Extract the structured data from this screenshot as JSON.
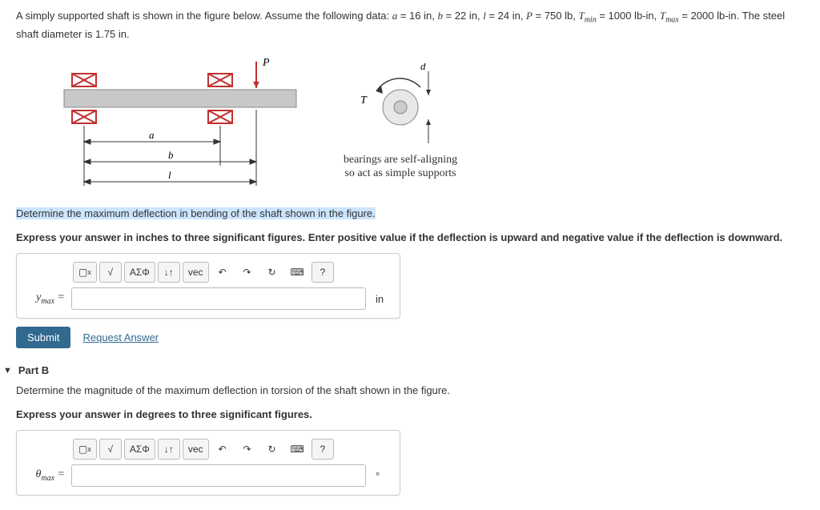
{
  "problem": {
    "intro": "A simply supported shaft is shown in the figure below. Assume the following data: ",
    "a_label": "a",
    "a_val": " = 16 in, ",
    "b_label": "b",
    "b_val": " = 22 in, ",
    "l_label": "l",
    "l_val": " = 24 in, ",
    "P_label": "P",
    "P_val": " = 750 lb, ",
    "Tmin_label": "T",
    "Tmin_sub": "min",
    "Tmin_val": " = 1000 lb-in, ",
    "Tmax_label": "T",
    "Tmax_sub": "max",
    "Tmax_val": " = 2000 lb-in. The steel shaft diameter is 1.75 in."
  },
  "figure": {
    "P": "P",
    "T": "T",
    "a": "a",
    "b": "b",
    "l": "l",
    "d": "d",
    "bearing_line1": "bearings are self-aligning",
    "bearing_line2": "so act as simple supports"
  },
  "partA": {
    "question": "Determine the maximum deflection in bending of the shaft shown in the figure.",
    "instruction": "Express your answer in inches to three significant figures. Enter positive value if the deflection is upward and negative value if the deflection is downward.",
    "var": "y",
    "var_sub": "max",
    "eq": " =",
    "unit": "in",
    "value": ""
  },
  "partB": {
    "title": "Part B",
    "question": "Determine the magnitude of the maximum deflection in torsion of the shaft shown in the figure.",
    "instruction": "Express your answer in degrees to three significant figures.",
    "var": "θ",
    "var_sub": "max",
    "eq": " =",
    "unit": "°",
    "value": ""
  },
  "toolbar": {
    "template": "▢",
    "sqrt": "√",
    "greek": "ΑΣΦ",
    "subsup": "↓↑",
    "vec": "vec",
    "undo": "↶",
    "redo": "↷",
    "reset": "↻",
    "keyboard": "⌨",
    "help": "?"
  },
  "buttons": {
    "submit": "Submit",
    "request": "Request Answer"
  }
}
